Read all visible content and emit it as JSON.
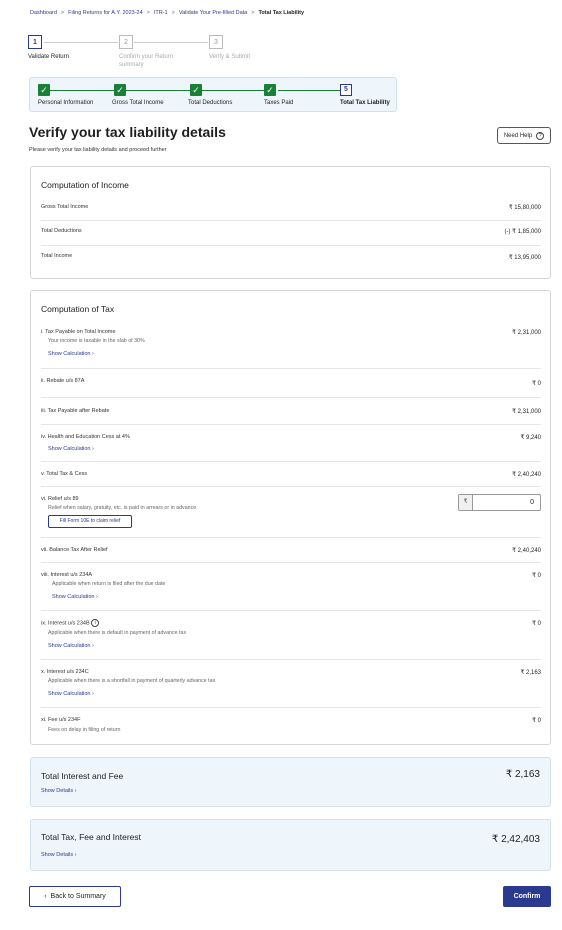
{
  "breadcrumb": [
    "Dashboard",
    "Filing Returns for A.Y. 2023-24",
    "ITR-1",
    "Validate Your Pre-filled Data",
    "Total Tax Liability"
  ],
  "breadcrumb_sep": ">",
  "outer_steps": [
    {
      "num": "1",
      "label": "Validate Return",
      "active": true
    },
    {
      "num": "2",
      "label": "Confirm your Return summary",
      "active": false
    },
    {
      "num": "3",
      "label": "Verify & Submit",
      "active": false
    }
  ],
  "inner_steps": [
    {
      "label": "Personal Information",
      "done": true
    },
    {
      "label": "Gross Total Income",
      "done": true
    },
    {
      "label": "Total Deductions",
      "done": true
    },
    {
      "label": "Taxes Paid",
      "done": true
    },
    {
      "label": "Total Tax Liability",
      "done": false,
      "num": "5"
    }
  ],
  "header": {
    "title": "Verify your tax liability details",
    "subtitle": "Please verify your tax liability details and proceed further",
    "need_help": "Need Help",
    "help_glyph": "?"
  },
  "income": {
    "title": "Computation of Income",
    "rows": [
      {
        "label": "Gross Total Income",
        "value": "₹ 15,80,000"
      },
      {
        "label": "Total Deductions",
        "value": "(-) ₹ 1,85,000"
      },
      {
        "label": "Total Income",
        "value": "₹ 13,95,000"
      }
    ]
  },
  "tax": {
    "title": "Computation of Tax",
    "rows": [
      {
        "label": "i. Tax Payable on Total Income",
        "value": "₹ 2,31,000",
        "desc": "Your income is taxable in the slab of 30%",
        "link": "Show Calculation"
      },
      {
        "label": "ii. Rebate u/s 87A",
        "value": "₹ 0"
      },
      {
        "label": "iii. Tax Payable after Rebate",
        "value": "₹ 2,31,000"
      },
      {
        "label": "iv. Health and Education Cess at 4%",
        "value": "₹ 9,240",
        "link": "Show Calculation"
      },
      {
        "label": "v. Total Tax & Cess",
        "value": "₹ 2,40,240"
      },
      {
        "label": "vi. Relief u/s 89",
        "desc": "Relief when salary, gratuity, etc. is paid in arrears or in advance",
        "input_value": "0",
        "input_currency": "₹",
        "button": "Fill Form 10E to claim relief"
      },
      {
        "label": "vii. Balance Tax After Relief",
        "value": "₹ 2,40,240"
      },
      {
        "label": "viii. Interest u/s 234A",
        "value": "₹ 0",
        "desc": "Applicable when return is filed after the due date",
        "link": "Show Calculation"
      },
      {
        "label": "ix. Interest u/s 234B",
        "value": "₹ 0",
        "desc": "Applicable when there is default in payment of advance tax",
        "link": "Show Calculation"
      },
      {
        "label": "x. Interest u/s 234C",
        "value": "₹ 2,163",
        "desc": "Applicable when there is a shortfall in payment of quarterly advance tax",
        "link": "Show Calculation"
      },
      {
        "label": "xi. Fee u/s 234F",
        "value": "₹ 0",
        "desc": "Fees on delay in filing of return"
      }
    ]
  },
  "summary": [
    {
      "title": "Total Interest and Fee",
      "value": "₹ 2,163",
      "link": "Show Details"
    },
    {
      "title": "Total Tax, Fee and Interest",
      "value": "₹ 2,42,403",
      "link": "Show Details"
    }
  ],
  "footer": {
    "back": "Back to Summary",
    "confirm": "Confirm"
  }
}
